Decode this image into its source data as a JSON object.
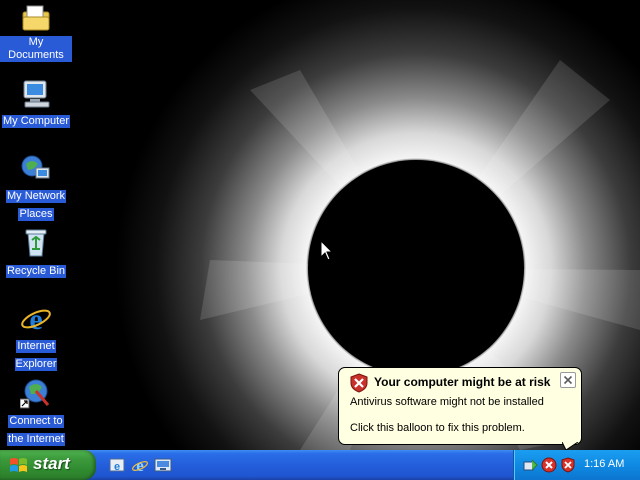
{
  "desktop": {
    "icons": [
      {
        "label_line1": "My Documents",
        "label_line2": "",
        "icon": "folder-documents-icon"
      },
      {
        "label_line1": "My Computer",
        "label_line2": "",
        "icon": "computer-icon"
      },
      {
        "label_line1": "My Network",
        "label_line2": "Places",
        "icon": "network-places-icon"
      },
      {
        "label_line1": "Recycle Bin",
        "label_line2": "",
        "icon": "recycle-bin-icon"
      },
      {
        "label_line1": "Internet",
        "label_line2": "Explorer",
        "icon": "internet-explorer-icon"
      },
      {
        "label_line1": "Connect to",
        "label_line2": "the Internet",
        "icon": "connect-internet-icon"
      }
    ],
    "wallpaper": "solar-eclipse"
  },
  "balloon": {
    "title": "Your computer might be at risk",
    "line1": "Antivirus software might not be installed",
    "line2": "Click this balloon to fix this problem.",
    "icon": "security-shield-icon",
    "close": "close-icon"
  },
  "taskbar": {
    "start_label": "start",
    "quick_launch": [
      "outlook-express-icon",
      "internet-explorer-icon",
      "show-desktop-icon"
    ],
    "tray_icons": [
      "network-connection-icon",
      "security-alert-icon",
      "security-shield-icon"
    ],
    "clock": "1:16 AM"
  },
  "colors": {
    "taskbar_blue": "#245edb",
    "start_green": "#3c9a3c",
    "tray_blue": "#0f8ae3",
    "balloon_bg": "#ffffe1",
    "label_highlight": "#2a5bd7"
  }
}
